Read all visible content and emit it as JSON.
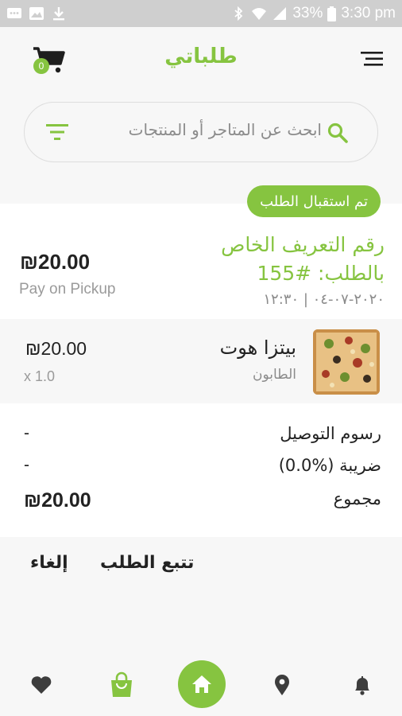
{
  "status_bar": {
    "battery": "33%",
    "time": "3:30 pm"
  },
  "header": {
    "title": "طلباتي",
    "cart_count": "0"
  },
  "search": {
    "placeholder": "ابحث عن المتاجر أو المنتجات"
  },
  "order": {
    "status": "تم استقبال الطلب",
    "id_label": "رقم التعريف الخاص بالطلب: #155",
    "date": "٢٠٢٠-٠٧-٠٤ | ١٢:٣٠",
    "total": "₪20.00",
    "payment_method": "Pay on Pickup"
  },
  "item": {
    "name": "بيتزا هوت",
    "store": "الطابون",
    "price": "₪20.00",
    "quantity": "x 1.0"
  },
  "summary": {
    "delivery_label": "رسوم التوصيل",
    "delivery_value": "-",
    "tax_label": "ضريبة (%0.0)",
    "tax_value": "-",
    "total_label": "مجموع",
    "total_value": "₪20.00"
  },
  "actions": {
    "track": "تتبع الطلب",
    "cancel": "إلغاء"
  },
  "colors": {
    "accent": "#86c440"
  },
  "nav_icons": [
    "heart-icon",
    "shopping-bag-icon",
    "home-icon",
    "location-icon",
    "bell-icon"
  ]
}
